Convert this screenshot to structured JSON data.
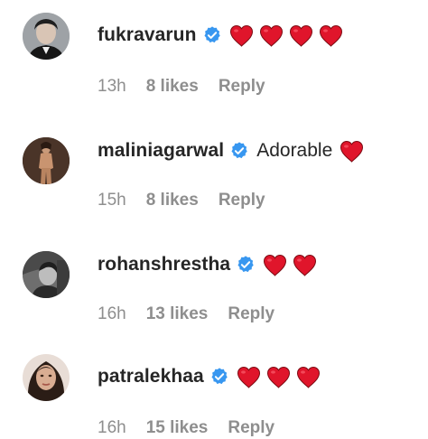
{
  "comments": [
    {
      "username": "fukravarun",
      "verified": true,
      "text": "",
      "hearts": 4,
      "time": "13h",
      "likes": "8 likes",
      "reply": "Reply"
    },
    {
      "username": "maliniagarwal",
      "verified": true,
      "text": "Adorable",
      "hearts": 1,
      "time": "15h",
      "likes": "8 likes",
      "reply": "Reply"
    },
    {
      "username": "rohanshrestha",
      "verified": true,
      "text": "",
      "hearts": 2,
      "time": "16h",
      "likes": "13 likes",
      "reply": "Reply"
    },
    {
      "username": "patralekhaa",
      "verified": true,
      "text": "",
      "hearts": 3,
      "time": "16h",
      "likes": "15 likes",
      "reply": "Reply"
    }
  ],
  "colors": {
    "username": "#262626",
    "meta": "#8e8e8e",
    "verified": "#3897f0",
    "heart": "#e0152b"
  },
  "icons": {
    "verified": "verified-badge-icon",
    "heart": "red-heart-emoji"
  }
}
